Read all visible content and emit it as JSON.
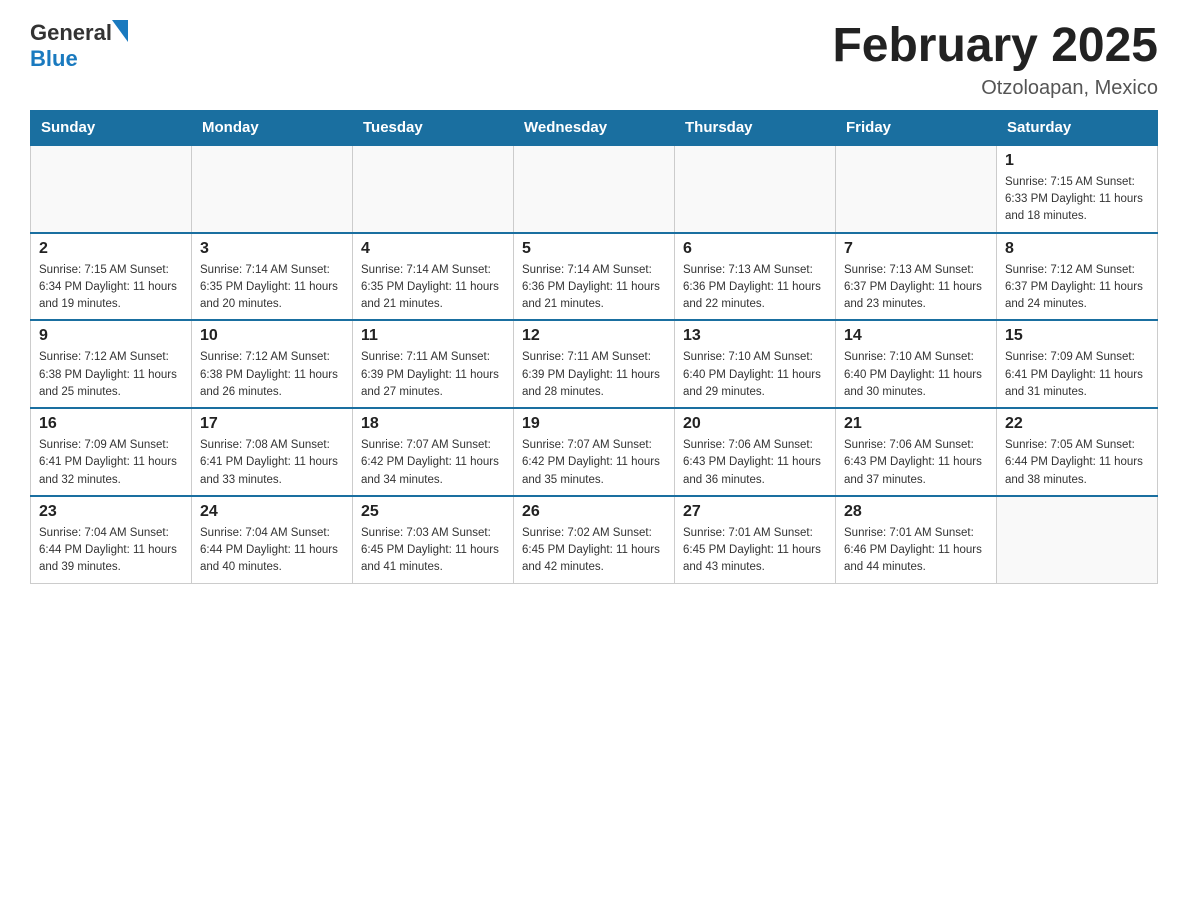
{
  "header": {
    "logo": {
      "general": "General",
      "blue": "Blue"
    },
    "title": "February 2025",
    "location": "Otzoloapan, Mexico"
  },
  "days_of_week": [
    "Sunday",
    "Monday",
    "Tuesday",
    "Wednesday",
    "Thursday",
    "Friday",
    "Saturday"
  ],
  "weeks": [
    [
      {
        "day": "",
        "info": ""
      },
      {
        "day": "",
        "info": ""
      },
      {
        "day": "",
        "info": ""
      },
      {
        "day": "",
        "info": ""
      },
      {
        "day": "",
        "info": ""
      },
      {
        "day": "",
        "info": ""
      },
      {
        "day": "1",
        "info": "Sunrise: 7:15 AM\nSunset: 6:33 PM\nDaylight: 11 hours\nand 18 minutes."
      }
    ],
    [
      {
        "day": "2",
        "info": "Sunrise: 7:15 AM\nSunset: 6:34 PM\nDaylight: 11 hours\nand 19 minutes."
      },
      {
        "day": "3",
        "info": "Sunrise: 7:14 AM\nSunset: 6:35 PM\nDaylight: 11 hours\nand 20 minutes."
      },
      {
        "day": "4",
        "info": "Sunrise: 7:14 AM\nSunset: 6:35 PM\nDaylight: 11 hours\nand 21 minutes."
      },
      {
        "day": "5",
        "info": "Sunrise: 7:14 AM\nSunset: 6:36 PM\nDaylight: 11 hours\nand 21 minutes."
      },
      {
        "day": "6",
        "info": "Sunrise: 7:13 AM\nSunset: 6:36 PM\nDaylight: 11 hours\nand 22 minutes."
      },
      {
        "day": "7",
        "info": "Sunrise: 7:13 AM\nSunset: 6:37 PM\nDaylight: 11 hours\nand 23 minutes."
      },
      {
        "day": "8",
        "info": "Sunrise: 7:12 AM\nSunset: 6:37 PM\nDaylight: 11 hours\nand 24 minutes."
      }
    ],
    [
      {
        "day": "9",
        "info": "Sunrise: 7:12 AM\nSunset: 6:38 PM\nDaylight: 11 hours\nand 25 minutes."
      },
      {
        "day": "10",
        "info": "Sunrise: 7:12 AM\nSunset: 6:38 PM\nDaylight: 11 hours\nand 26 minutes."
      },
      {
        "day": "11",
        "info": "Sunrise: 7:11 AM\nSunset: 6:39 PM\nDaylight: 11 hours\nand 27 minutes."
      },
      {
        "day": "12",
        "info": "Sunrise: 7:11 AM\nSunset: 6:39 PM\nDaylight: 11 hours\nand 28 minutes."
      },
      {
        "day": "13",
        "info": "Sunrise: 7:10 AM\nSunset: 6:40 PM\nDaylight: 11 hours\nand 29 minutes."
      },
      {
        "day": "14",
        "info": "Sunrise: 7:10 AM\nSunset: 6:40 PM\nDaylight: 11 hours\nand 30 minutes."
      },
      {
        "day": "15",
        "info": "Sunrise: 7:09 AM\nSunset: 6:41 PM\nDaylight: 11 hours\nand 31 minutes."
      }
    ],
    [
      {
        "day": "16",
        "info": "Sunrise: 7:09 AM\nSunset: 6:41 PM\nDaylight: 11 hours\nand 32 minutes."
      },
      {
        "day": "17",
        "info": "Sunrise: 7:08 AM\nSunset: 6:41 PM\nDaylight: 11 hours\nand 33 minutes."
      },
      {
        "day": "18",
        "info": "Sunrise: 7:07 AM\nSunset: 6:42 PM\nDaylight: 11 hours\nand 34 minutes."
      },
      {
        "day": "19",
        "info": "Sunrise: 7:07 AM\nSunset: 6:42 PM\nDaylight: 11 hours\nand 35 minutes."
      },
      {
        "day": "20",
        "info": "Sunrise: 7:06 AM\nSunset: 6:43 PM\nDaylight: 11 hours\nand 36 minutes."
      },
      {
        "day": "21",
        "info": "Sunrise: 7:06 AM\nSunset: 6:43 PM\nDaylight: 11 hours\nand 37 minutes."
      },
      {
        "day": "22",
        "info": "Sunrise: 7:05 AM\nSunset: 6:44 PM\nDaylight: 11 hours\nand 38 minutes."
      }
    ],
    [
      {
        "day": "23",
        "info": "Sunrise: 7:04 AM\nSunset: 6:44 PM\nDaylight: 11 hours\nand 39 minutes."
      },
      {
        "day": "24",
        "info": "Sunrise: 7:04 AM\nSunset: 6:44 PM\nDaylight: 11 hours\nand 40 minutes."
      },
      {
        "day": "25",
        "info": "Sunrise: 7:03 AM\nSunset: 6:45 PM\nDaylight: 11 hours\nand 41 minutes."
      },
      {
        "day": "26",
        "info": "Sunrise: 7:02 AM\nSunset: 6:45 PM\nDaylight: 11 hours\nand 42 minutes."
      },
      {
        "day": "27",
        "info": "Sunrise: 7:01 AM\nSunset: 6:45 PM\nDaylight: 11 hours\nand 43 minutes."
      },
      {
        "day": "28",
        "info": "Sunrise: 7:01 AM\nSunset: 6:46 PM\nDaylight: 11 hours\nand 44 minutes."
      },
      {
        "day": "",
        "info": ""
      }
    ]
  ]
}
